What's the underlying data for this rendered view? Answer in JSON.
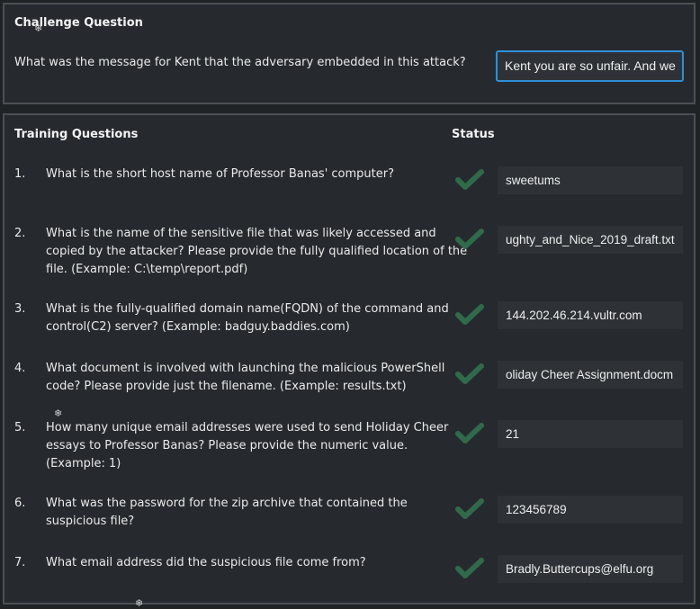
{
  "challenge": {
    "title": "Challenge Question",
    "question": "What was the message for Kent that the adversary embedded in this attack?",
    "answer": "Kent you are so unfair. And we"
  },
  "training": {
    "title": "Training Questions",
    "status_header": "Status",
    "questions": [
      {
        "num": "1.",
        "lines": [
          "What is the short host name of Professor Banas' computer?"
        ],
        "answer": "sweetums",
        "status": "check-icon"
      },
      {
        "num": "2.",
        "lines": [
          "What is the name of the sensitive file that was likely accessed and",
          "copied by the attacker? Please provide the fully qualified location of the",
          "file. (Example: C:\\temp\\report.pdf)"
        ],
        "answer": "ughty_and_Nice_2019_draft.txt",
        "status": "check-icon"
      },
      {
        "num": "3.",
        "lines": [
          "What is the fully-qualified domain name(FQDN) of the command and",
          "control(C2) server? (Example: badguy.baddies.com)"
        ],
        "answer": "144.202.46.214.vultr.com",
        "status": "check-icon"
      },
      {
        "num": "4.",
        "lines": [
          "What document is involved with launching the malicious PowerShell",
          "code? Please provide just the filename. (Example: results.txt)"
        ],
        "answer": "oliday Cheer Assignment.docm",
        "status": "check-icon"
      },
      {
        "num": "5.",
        "lines": [
          "How many unique email addresses were used to send Holiday Cheer",
          "essays to Professor Banas? Please provide the numeric value.",
          "(Example: 1)"
        ],
        "answer": "21",
        "status": "check-icon"
      },
      {
        "num": "6.",
        "lines": [
          "What was the password for the zip archive that contained the",
          "suspicious file?"
        ],
        "answer": "123456789",
        "status": "check-icon"
      },
      {
        "num": "7.",
        "lines": [
          "What email address did the suspicious file come from?"
        ],
        "answer": "Bradly.Buttercups@elfu.org",
        "status": "check-icon"
      }
    ]
  },
  "colors": {
    "background": "#1f2326",
    "panel": "#262a2e",
    "panel_border": "#4b5055",
    "field": "#2e3236",
    "focus_border": "#2f8fd8",
    "check": "#2f6b4a"
  },
  "decor": {
    "snowflake_icon": "snowflake-icon"
  }
}
